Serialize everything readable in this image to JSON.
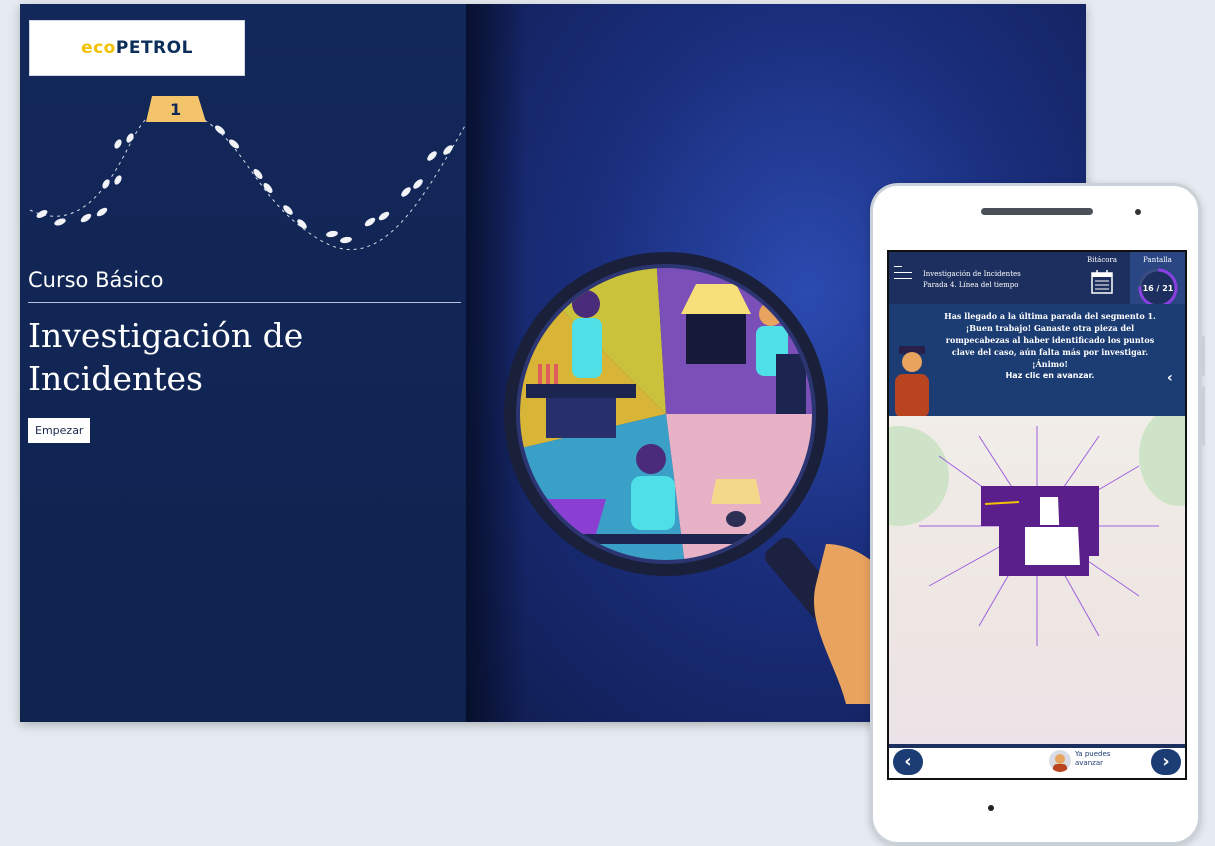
{
  "desktop": {
    "logo": {
      "eco": "eco",
      "petrol": "PETROL"
    },
    "step_marker": "1",
    "subtitle": "Curso Básico",
    "title": "Investigación de Incidentes",
    "start_label": "Empezar"
  },
  "mobile": {
    "header": {
      "course_title": "Investigación de Incidentes",
      "stop_title": "Parada 4. Línea del tiempo",
      "bitacora_label": "Bitácora",
      "screen_label": "Pantalla",
      "progress_text": "16 / 21",
      "progress_current": 16,
      "progress_total": 21
    },
    "message": {
      "text": "Has llegado a la última parada del segmento 1. ¡Buen trabajo! Ganaste otra pieza del rompecabezas al haber identificado los puntos clave del caso, aún falta más por investigar. ¡Ánimo!",
      "cta": "Haz clic en avanzar."
    },
    "footer": {
      "prev_label": "‹",
      "next_label": "›",
      "status_text": "Ya puedes avanzar"
    }
  },
  "colors": {
    "navy": "#13285a",
    "accent_blue": "#1c3c74",
    "purple": "#5a1f8a",
    "eco_yellow": "#f2c200"
  }
}
